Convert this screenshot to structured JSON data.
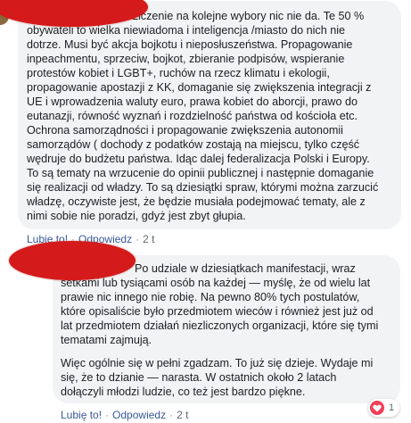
{
  "comment1": {
    "lines": [
      "Liczenie na kolejne wybory nic nie da. Te 50 %",
      "obywateli to wielka niewiadoma i inteligencja /miasto do nich nie",
      "dotrze. Musi być akcja bojkotu i nieposłuszeństwa. Propagowanie",
      "inpeachmentu, sprzeciw, bojkot, zbieranie podpisów, wspieranie",
      "protestów kobiet i LGBT+, ruchów na rzecz klimatu i ekologii,",
      "propagowanie apostazji z KK, domaganie się zwiększenia integracji z",
      "UE i wprowadzenia waluty euro, prawa kobiet do aborcji, prawo do",
      "eutanazji, równość wyznań i rozdzielność państwa od kościoła etc.",
      "Ochrona samorządności i propagowanie zwiększenia autonomii",
      "samorządów ( dochody z podatków zostają na miejscu, tylko część",
      "wędruje do budżetu państwa. Idąc dalej federalizacja Polski i Europy.",
      "To są tematy na wrzucenie do opinii publicznej i następnie domaganie",
      "się realizacji od władzy. To są dziesiątki spraw, którymi można zarzucić",
      "władzę, oczywiste jest, że będzie musiała podejmować tematy, ale z",
      "nimi sobie nie poradzi, gdyż jest zbyt głupia."
    ],
    "actions": {
      "like": "Lubię to!",
      "reply": "Odpowiedz",
      "time": "2 t"
    }
  },
  "comment2": {
    "para1": [
      "Po udziale w dziesiątkach manifestacji, wraz",
      "setkami lub tysiącami osób na każdej — myślę, że od wielu lat",
      "prawie nic innego nie robię. Na pewno 80% tych postulatów,",
      "które opisaliście było przedmiotem wieców i również jest już od",
      "lat przedmiotem działań niezliczonych organizacji, które się tymi",
      "tematami zajmują."
    ],
    "para2": [
      "Więc ogólnie się w pełni zgadzam. To już się dzieje. Wydaje mi",
      "się, że to dzianie — narasta. W ostatnich około 2 latach",
      "dołączyli młodzi ludzie, co też jest bardzo piękne."
    ],
    "actions": {
      "like": "Lubię to!",
      "reply": "Odpowiedz",
      "time": "2 t"
    },
    "reaction_count": "1",
    "reaction_icon": "heart-icon",
    "reaction_color": "#f33e58"
  },
  "colors": {
    "link": "#385898",
    "bubble": "#f2f3f5",
    "redaction": "#d41a1a"
  }
}
